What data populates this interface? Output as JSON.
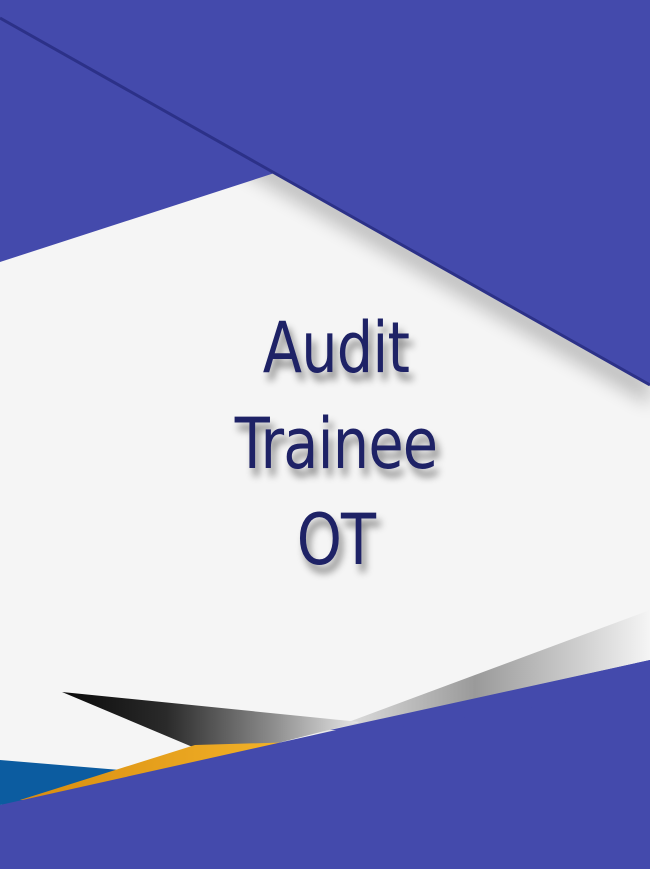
{
  "title": {
    "lines": [
      "Audit",
      "Trainee",
      "OT"
    ]
  },
  "colors": {
    "background": "#f5f5f5",
    "accent_primary": "#444aac",
    "text": "#1e2266",
    "accent_gold": "#f0a81a",
    "accent_blue": "#0c5ca0",
    "accent_dark": "#111111"
  }
}
